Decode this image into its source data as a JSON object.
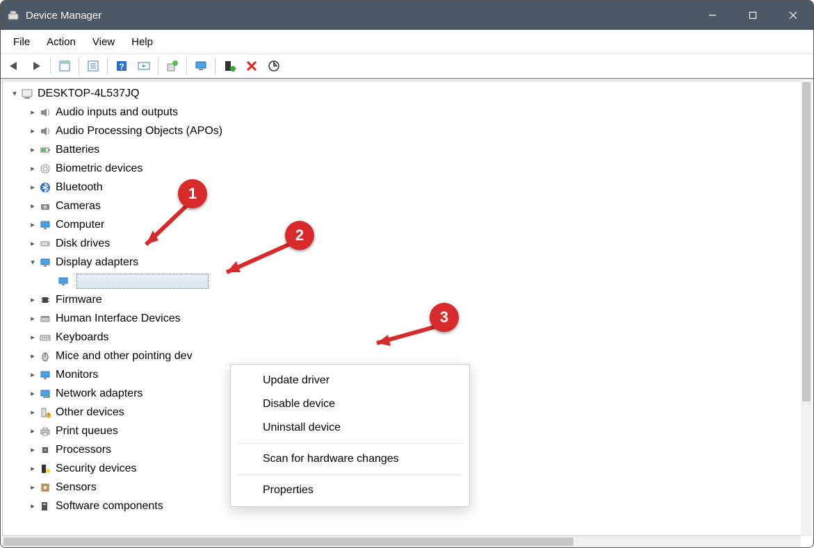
{
  "window": {
    "title": "Device Manager"
  },
  "menubar": {
    "file": "File",
    "action": "Action",
    "view": "View",
    "help": "Help"
  },
  "tree": {
    "root": "DESKTOP-4L537JQ",
    "nodes": {
      "audio_io": "Audio inputs and outputs",
      "apo": "Audio Processing Objects (APOs)",
      "batteries": "Batteries",
      "biometric": "Biometric devices",
      "bluetooth": "Bluetooth",
      "cameras": "Cameras",
      "computer": "Computer",
      "disk": "Disk drives",
      "display": "Display adapters",
      "firmware": "Firmware",
      "hid": "Human Interface Devices",
      "keyboards": "Keyboards",
      "mice": "Mice and other pointing dev",
      "monitors": "Monitors",
      "network": "Network adapters",
      "other": "Other devices",
      "print": "Print queues",
      "processors": "Processors",
      "security": "Security devices",
      "sensors": "Sensors",
      "software": "Software components"
    }
  },
  "context_menu": {
    "update": "Update driver",
    "disable": "Disable device",
    "uninstall": "Uninstall device",
    "scan": "Scan for hardware changes",
    "properties": "Properties"
  },
  "annotations": {
    "b1": "1",
    "b2": "2",
    "b3": "3"
  }
}
